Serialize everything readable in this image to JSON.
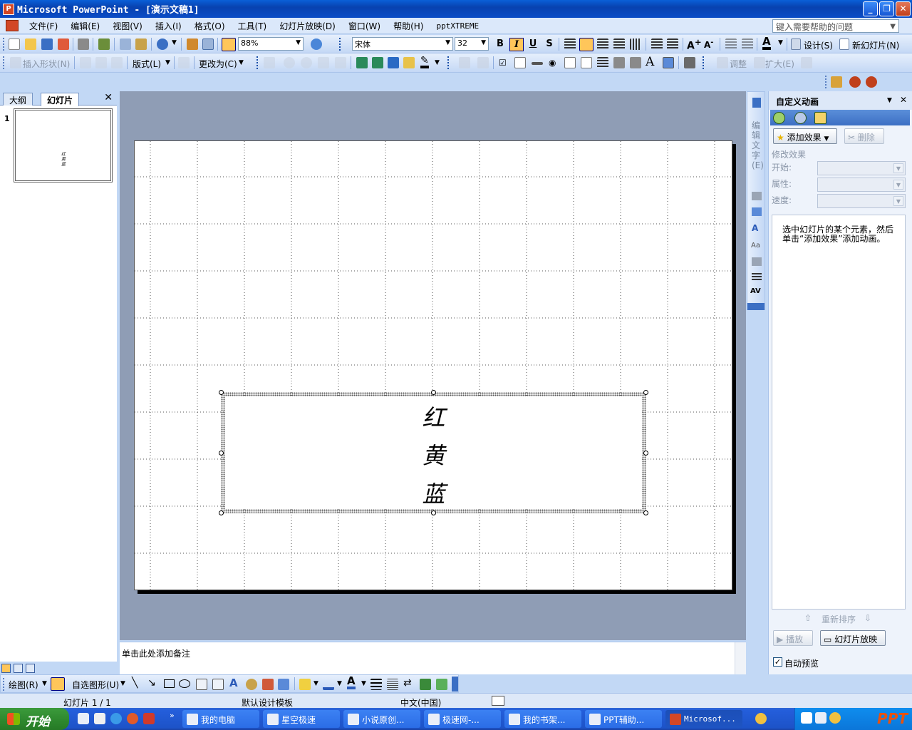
{
  "window": {
    "title": "Microsoft PowerPoint - [演示文稿1]",
    "app_icon": "powerpoint-icon",
    "controls": [
      "minimize",
      "restore",
      "close"
    ]
  },
  "menu": {
    "items": [
      "文件(F)",
      "编辑(E)",
      "视图(V)",
      "插入(I)",
      "格式(O)",
      "工具(T)",
      "幻灯片放映(D)",
      "窗口(W)",
      "帮助(H)",
      "pptXTREME"
    ],
    "help_placeholder": "键入需要帮助的问题"
  },
  "standard_toolbar": {
    "zoom": "88%",
    "font_name": "宋体",
    "font_size": "32",
    "bold": "B",
    "italic": "I",
    "underline": "U",
    "shadow": "S",
    "design_label": "设计(S)",
    "new_slide_label": "新幻灯片(N)"
  },
  "diagram_toolbar": {
    "insert_shape": "插入形状(N)",
    "layout": "版式(L)",
    "change_to": "更改为(C)",
    "adjust": "调整",
    "expand": "扩大(E)"
  },
  "left_pane": {
    "tabs": [
      "大纲",
      "幻灯片"
    ],
    "active_tab": "幻灯片",
    "slide_number": "1",
    "thumb_lines": [
      "红",
      "黄",
      "蓝"
    ]
  },
  "slide": {
    "text_lines": [
      "红",
      "黄",
      "蓝"
    ]
  },
  "notes": {
    "placeholder": "单击此处添加备注"
  },
  "vertical_toolbar": {
    "label": "编辑文字(E)"
  },
  "task_pane": {
    "title": "自定义动画",
    "add_effect": "添加效果",
    "remove": "删除",
    "modify_title": "修改效果",
    "start_label": "开始:",
    "property_label": "属性:",
    "speed_label": "速度:",
    "hint": "选中幻灯片的某个元素，然后单击“添加效果”添加动画。",
    "reorder": "重新排序",
    "play": "播放",
    "slideshow": "幻灯片放映",
    "autopreview": "自动预览",
    "autopreview_checked": true
  },
  "drawing_toolbar": {
    "draw": "绘图(R)",
    "autoshapes": "自选图形(U)"
  },
  "status": {
    "slide": "幻灯片 1 / 1",
    "template": "默认设计模板",
    "language": "中文(中国)"
  },
  "taskbar": {
    "start": "开始",
    "tasks": [
      "我的电脑",
      "星空极速",
      "小说原创...",
      "极速网-...",
      "我的书架...",
      "PPT辅助...",
      "Microsof..."
    ],
    "tray_brand": "PPT"
  },
  "colors": {
    "titlebar": "#0a4cc6",
    "workarea": "#8f9db5",
    "highlight": "#ffc65a"
  }
}
